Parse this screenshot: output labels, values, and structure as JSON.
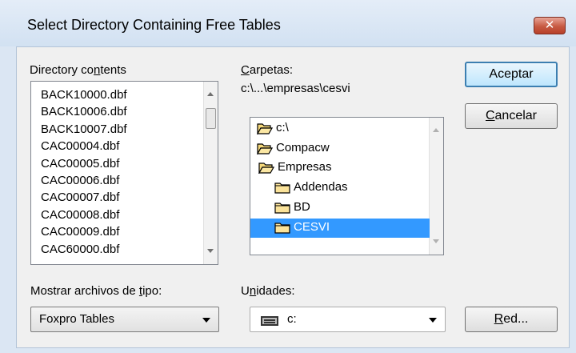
{
  "window": {
    "title": "Select Directory Containing Free Tables",
    "close_glyph": "✕"
  },
  "files": {
    "label_prefix": "Directory co",
    "label_accel": "n",
    "label_suffix": "tents",
    "items": [
      "BACK10000.dbf",
      "BACK10006.dbf",
      "BACK10007.dbf",
      "CAC00004.dbf",
      "CAC00005.dbf",
      "CAC00006.dbf",
      "CAC00007.dbf",
      "CAC00008.dbf",
      "CAC00009.dbf",
      "CAC60000.dbf"
    ]
  },
  "folders": {
    "label_accel": "C",
    "label_rest": "arpetas:",
    "current_path": "c:\\...\\empresas\\cesvi",
    "items": [
      {
        "name": "c:\\",
        "icon": "open-folder-icon",
        "selected": false
      },
      {
        "name": "Compacw",
        "icon": "open-folder-icon",
        "selected": false
      },
      {
        "name": "Empresas",
        "icon": "open-folder-icon",
        "selected": false
      },
      {
        "name": "Addendas",
        "icon": "folder-icon",
        "selected": false
      },
      {
        "name": "BD",
        "icon": "folder-icon",
        "selected": false
      },
      {
        "name": "CESVI",
        "icon": "folder-icon",
        "selected": true
      }
    ]
  },
  "buttons": {
    "ok": "Aceptar",
    "cancel_accel": "C",
    "cancel_rest": "ancelar",
    "network_accel": "R",
    "network_rest": "ed..."
  },
  "filetype": {
    "label_prefix": "Mostrar archivos de ",
    "label_accel": "t",
    "label_suffix": "ipo:",
    "selected": "Foxpro Tables"
  },
  "drives": {
    "label_prefix": "U",
    "label_accel": "n",
    "label_suffix": "idades:",
    "selected": "c:",
    "icon": "drive-icon"
  },
  "colors": {
    "selection": "#3399ff",
    "default_button_border": "#3c7fb1",
    "close_button": "#c75a42"
  }
}
